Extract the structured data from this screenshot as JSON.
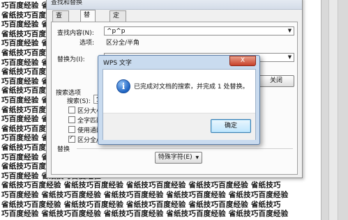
{
  "document": {
    "lines": [
      "巧百度经验    省纸技巧百度经验",
      "省纸技巧百度经验    省纸技巧百度",
      "巧百度经验    省纸技巧百度经验",
      "省纸技巧百度经验    省纸技巧百度",
      "巧百度经验    省纸技巧百度经验",
      "省纸技巧百度经验    省纸技巧百度",
      "巧百度经验    省纸技巧百度经验",
      "省纸技巧百度经验    省纸技巧百度",
      "巧百度经验    省纸技巧百度经验",
      "省纸技巧百度经验    省纸技巧百度",
      "巧百度经验    省纸技巧百度经验",
      "省纸技巧百度经验    省纸技巧百度",
      "巧百度经验    省纸技巧百度经验",
      "省纸技巧百度经验    省纸技巧百度",
      "巧百度经验    省纸技巧百度经验",
      "省纸技巧百度经验    省纸技巧百度",
      "巧百度经验    省纸技巧百度经验",
      "省纸技巧百度经验    省纸技巧百度",
      "巧百度经验    省纸技巧百度经验",
      "省纸技巧百度经验    省纸技巧百度经验    省纸技巧百度经验    省纸技巧百度经验    省纸技巧",
      "巧百度经验    省纸技巧百度经验    省纸技巧百度经验    省纸技巧百度经验    省纸技巧百度经验",
      "省纸技巧百度经验    省纸技巧百度经验    省纸技巧百度经验    省纸技巧百度经验    省纸技巧",
      "巧百度经验    省纸技巧百度经验    省纸技巧百度经验    省纸技巧百度经验    省纸技巧百度经验"
    ]
  },
  "find_replace": {
    "title": "查找和替换",
    "tabs": [
      "查找(D)",
      "替换(P)",
      "定位(G)"
    ],
    "find_label": "查找内容(N):",
    "find_value": "^p^p",
    "options_label": "选项:",
    "options_value": "区分全/半角",
    "replace_label": "替换为(I):",
    "replace_value": "",
    "close_button": "关闭",
    "search_options_label": "搜索选项",
    "search_label": "搜索(S):",
    "search_value": "全",
    "checkboxes": [
      {
        "label": "区分大小",
        "checked": false
      },
      {
        "label": "全字匹配",
        "checked": false
      },
      {
        "label": "使用通配",
        "checked": false
      },
      {
        "label": "区分全/半",
        "checked": true
      }
    ],
    "replace_section": "替换",
    "special_button": "特殊字符(E)"
  },
  "message_box": {
    "title": "WPS 文字",
    "close_label": "X",
    "message": "已完成对文档的搜索，并完成 1 处替换。",
    "ok_button": "确定"
  }
}
